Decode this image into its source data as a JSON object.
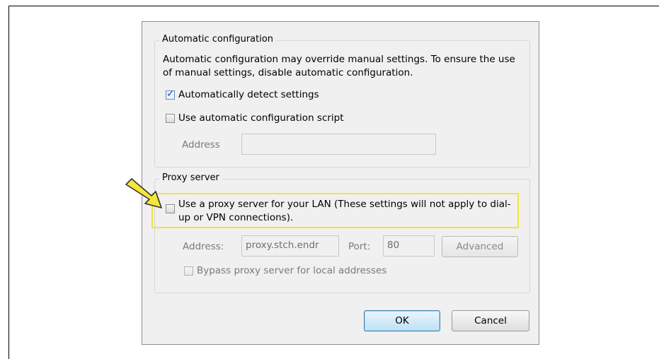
{
  "auto_config": {
    "legend": "Automatic configuration",
    "description": "Automatic configuration may override manual settings.  To ensure the use of manual settings, disable automatic configuration.",
    "auto_detect": {
      "label": "Automatically detect settings",
      "checked": true
    },
    "auto_script": {
      "label": "Use automatic configuration script",
      "checked": false
    },
    "address_label": "Address",
    "address_value": ""
  },
  "proxy": {
    "legend": "Proxy server",
    "use_proxy": {
      "label": "Use a proxy server for your LAN (These settings will not apply to dial-up or VPN connections).",
      "checked": false
    },
    "address_label": "Address:",
    "address_value": "proxy.stch.endr",
    "port_label": "Port:",
    "port_value": "80",
    "advanced_label": "Advanced",
    "bypass": {
      "label": "Bypass proxy server for local addresses",
      "checked": false
    }
  },
  "buttons": {
    "ok": "OK",
    "cancel": "Cancel"
  },
  "colors": {
    "highlight": "#f1e33d",
    "arrow": "#f5e63a"
  },
  "icons": {
    "pointer": "arrow-pointer-icon",
    "check": "checkmark-icon"
  }
}
